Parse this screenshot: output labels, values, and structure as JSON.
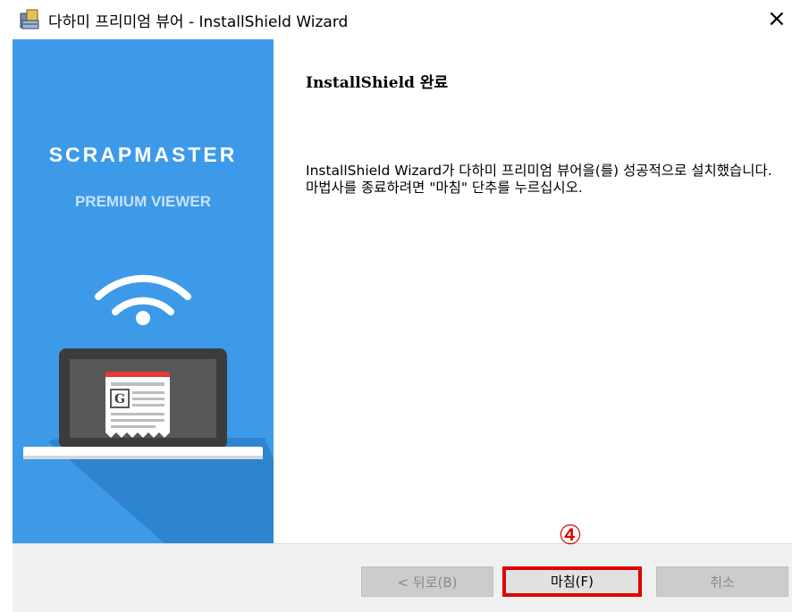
{
  "window": {
    "title": "다하미 프리미엄 뷰어 - InstallShield Wizard",
    "close_glyph": "×",
    "icon": "installer-icon"
  },
  "side": {
    "brand": "SCRAPMASTER",
    "subtitle": "PREMIUM VIEWER",
    "art_icons": [
      "wifi-icon",
      "laptop-icon",
      "newspaper-icon"
    ],
    "colors": {
      "panel": "#3d9ae8",
      "shadow": "#2f84cf"
    }
  },
  "main": {
    "heading": "InstallShield 완료",
    "message": "InstallShield Wizard가 다하미 프리미엄 뷰어을(를) 성공적으로 설치했습니다. 마법사를 종료하려면 \"마침\" 단추를 누르십시오."
  },
  "footer": {
    "back_label": "< 뒤로(B)",
    "finish_label": "마침(F)",
    "cancel_label": "취소",
    "step_marker": "④",
    "highlight_color": "#e00000"
  }
}
